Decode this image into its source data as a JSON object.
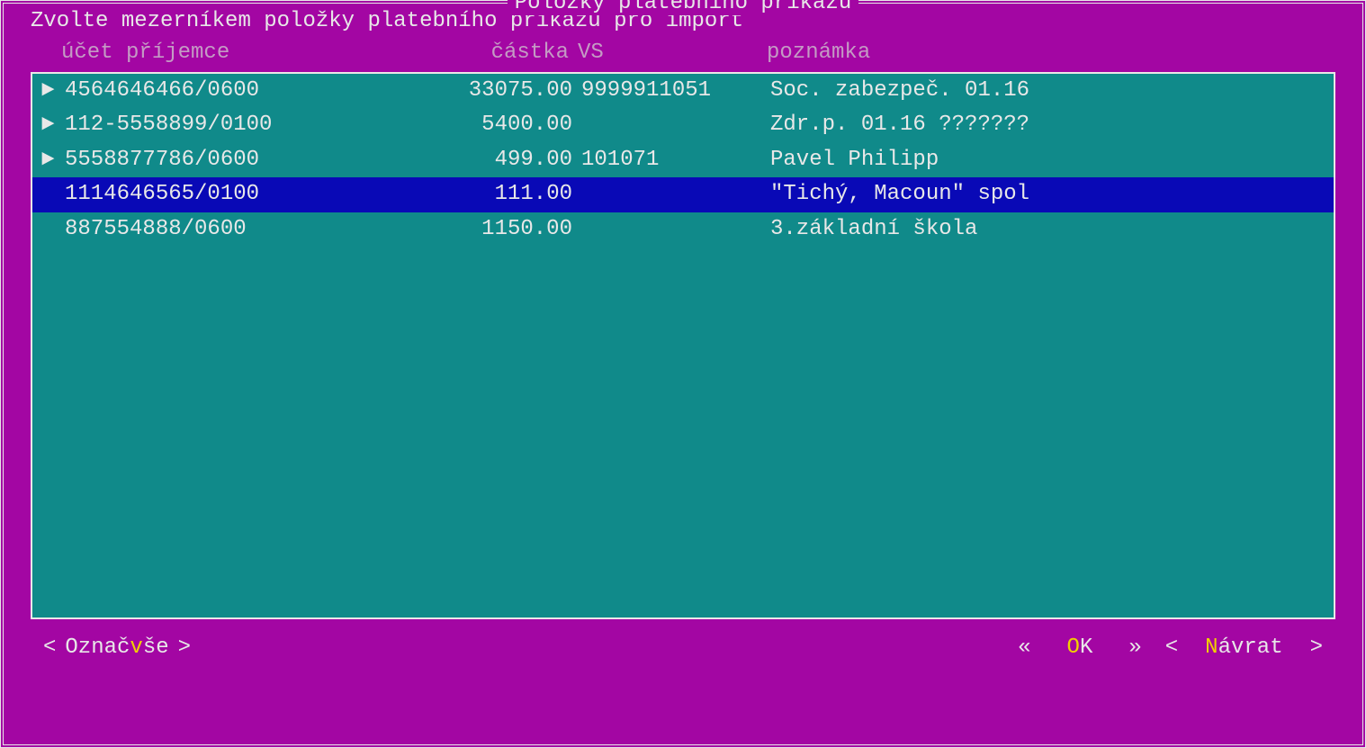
{
  "title": " Položky platebního příkazu ",
  "instruction": "Zvolte mezerníkem položky platebního příkazu pro import",
  "headers": {
    "account": "účet příjemce",
    "amount": "částka",
    "vs": "VS",
    "note": "poznámka"
  },
  "rows": [
    {
      "marker": "►",
      "account": "4564646466/0600",
      "amount": "33075.00",
      "vs": "9999911051",
      "note": "Soc. zabezpeč. 01.16",
      "active": false
    },
    {
      "marker": "►",
      "account": "112-5558899/0100",
      "amount": "5400.00",
      "vs": "",
      "note": "Zdr.p. 01.16 ???????",
      "active": false
    },
    {
      "marker": "►",
      "account": "5558877786/0600",
      "amount": "499.00",
      "vs": "101071",
      "note": "Pavel Philipp",
      "active": false
    },
    {
      "marker": "",
      "account": "1114646565/0100",
      "amount": "111.00",
      "vs": "",
      "note": "\"Tichý, Macoun\" spol",
      "active": true
    },
    {
      "marker": "",
      "account": "887554888/0600",
      "amount": "1150.00",
      "vs": "",
      "note": "3.základní škola",
      "active": false
    }
  ],
  "buttons": {
    "markall_pre": "Označ ",
    "markall_hot": "v",
    "markall_post": "še",
    "ok_hot": "O",
    "ok_post": "K",
    "return_hot": "N",
    "return_post": "ávrat",
    "angle_open": "<",
    "angle_close": ">",
    "dbl_open": "«",
    "dbl_close": "»"
  }
}
